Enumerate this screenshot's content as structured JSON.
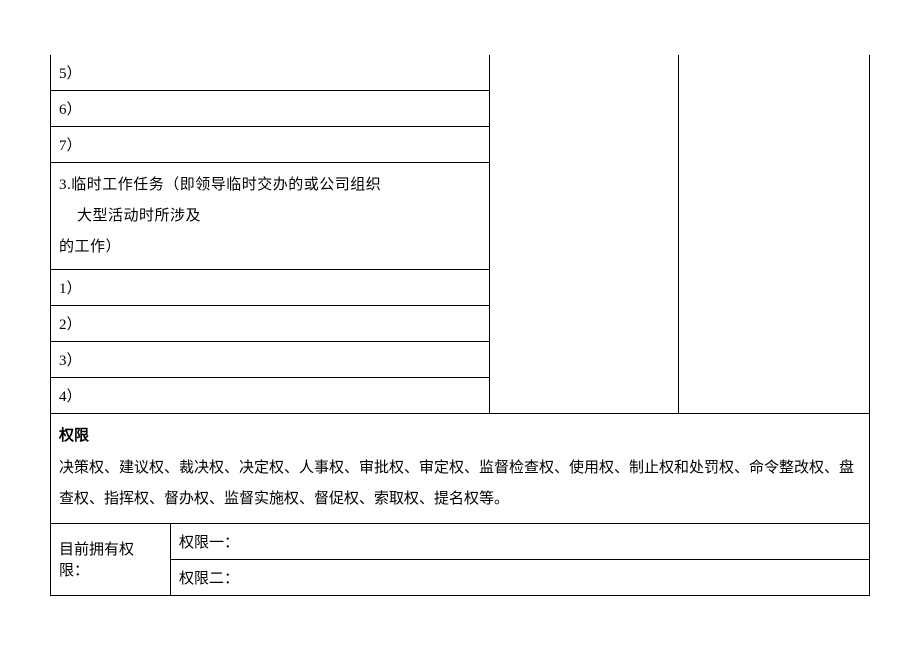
{
  "numbered_items_top": [
    "5）",
    "6）",
    "7）"
  ],
  "temp_task_header_line1a": "3.临时工作任务（即领导临时交办的或公司组织",
  "temp_task_header_line1b": "大型活动时所涉及",
  "temp_task_header_line2": "的工作）",
  "numbered_items_bottom": [
    "1）",
    "2）",
    "3）",
    "4）"
  ],
  "authority": {
    "title": "权限",
    "description_line1": "决策权、建议权、裁决权、决定权、人事权、审批权、审定权、监督检查权、使用权、制止权和处罚权、命令整改权、盘",
    "description_line2": "查权、指挥权、督办权、监督实施权、督促权、索取权、提名权等。",
    "current_label": "目前拥有权限：",
    "permission_1": "权限一：",
    "permission_2": "权限二："
  }
}
